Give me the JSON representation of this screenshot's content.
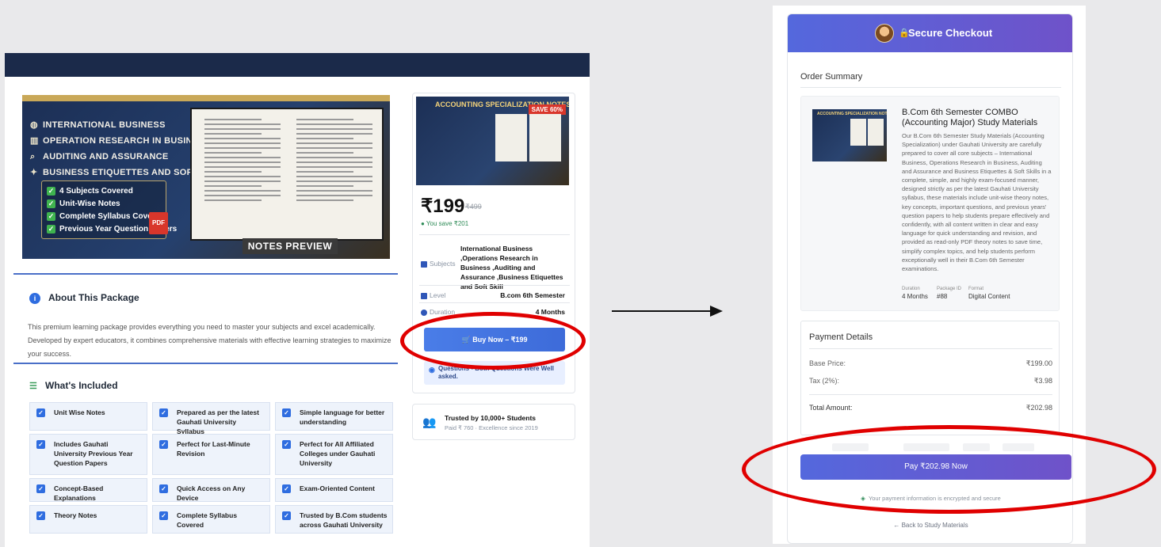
{
  "left": {
    "hero": {
      "topics": [
        "INTERNATIONAL BUSINESS",
        "OPERATION RESEARCH IN BUSINESS",
        "AUDITING AND ASSURANCE",
        "BUSINESS ETIQUETTES AND SOFT SKILLS"
      ],
      "checks": [
        "4 Subjects Covered",
        "Unit-Wise Notes",
        "Complete Syllabus Covered",
        "Previous Year Question Papers"
      ],
      "pdf_label": "PDF",
      "preview_label": "NOTES PREVIEW"
    },
    "about": {
      "heading": "About This Package",
      "text": "This premium learning package provides everything you need to master your subjects and excel academically. Developed by expert educators, it combines comprehensive materials with effective learning strategies to maximize your success."
    },
    "included": {
      "heading": "What's Included",
      "items": [
        "Unit Wise Notes",
        "Prepared as per the latest Gauhati University Syllabus",
        "Simple language for better understanding",
        "Includes Gauhati University Previous Year Question Papers",
        "Perfect for Last-Minute Revision",
        "Perfect for All Affiliated Colleges under Gauhati University",
        "Concept-Based Explanations",
        "Quick Access on Any Device",
        "Exam-Oriented Content",
        "Theory Notes",
        "Complete Syllabus Covered",
        "Trusted by B.Com students across Gauhati University"
      ]
    },
    "side": {
      "thumb_title": "ACCOUNTING SPECIALIZATION NOTES",
      "save_badge": "SAVE 60%",
      "price": "₹199",
      "old_price": "₹499",
      "you_save": "You save ₹201",
      "subjects_label": "Subjects",
      "subjects_value": "International Business ,Operations Research in Business ,Auditing and Assurance ,Business Etiquettes and Soft Skill",
      "level_label": "Level",
      "level_value": "B.com 6th Semester",
      "duration_label": "Duration",
      "duration_value": "4 Months",
      "buy_label": "Buy Now – ₹199",
      "note_text": "Questions - Both Questions Were Well asked."
    },
    "trusted": {
      "title": "Trusted by 10,000+ Students",
      "subtitle": "Paid ₹ 760 · Excellence since 2019"
    }
  },
  "checkout": {
    "header_title": "Secure Checkout",
    "order_summary_label": "Order Summary",
    "product_title": "B.Com 6th Semester COMBO (Accounting Major) Study Materials",
    "product_desc": "Our B.Com 6th Semester Study Materials (Accounting Specialization) under Gauhati University are carefully prepared to cover all core subjects – International Business, Operations Research in Business, Auditing and Assurance and Business Etiquettes & Soft Skills in a complete, simple, and highly exam-focused manner, designed strictly as per the latest Gauhati University syllabus, these materials include unit-wise theory notes, key concepts, important questions, and previous years' question papers to help students prepare effectively and confidently, with all content written in clear and easy language for quick understanding and revision, and provided as read-only PDF theory notes to save time, simplify complex topics, and help students perform exceptionally well in their B.Com 6th Semester examinations.",
    "meta": {
      "duration_label": "Duration",
      "duration_value": "4 Months",
      "package_label": "Package ID",
      "package_value": "#88",
      "format_label": "Format",
      "format_value": "Digital Content"
    },
    "payment_details_label": "Payment Details",
    "base_price_label": "Base Price:",
    "base_price_value": "₹199.00",
    "tax_label": "Tax (2%):",
    "tax_value": "₹3.98",
    "total_label": "Total Amount:",
    "total_value": "₹202.98",
    "pay_button": "Pay ₹202.98 Now",
    "secure_note": "Your payment information is encrypted and secure",
    "back_link": "← Back to Study Materials"
  },
  "colors": {
    "accent_blue": "#3d6bd9",
    "checkout_gradient_start": "#5468dd",
    "checkout_gradient_end": "#6f52c9",
    "highlight_red": "#e00000",
    "navbar": "#1b2a4a"
  }
}
